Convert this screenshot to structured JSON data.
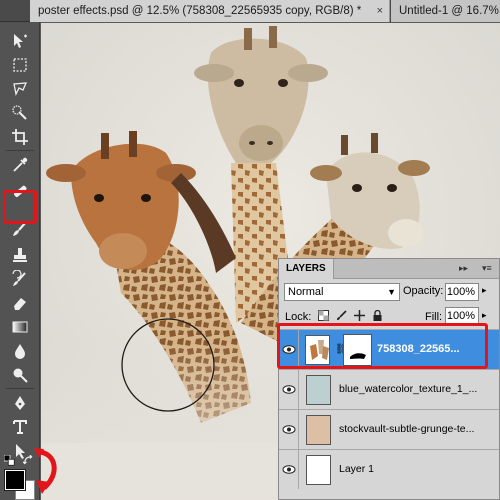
{
  "tabs": [
    {
      "title": "poster effects.psd @ 12.5% (758308_22565935 copy, RGB/8) *",
      "close": "×"
    },
    {
      "title": "Untitled-1 @ 16.7%"
    }
  ],
  "toolbar": {
    "tools": [
      "move-tool",
      "marquee-tool",
      "lasso-tool",
      "quick-selection-tool",
      "crop-tool",
      "eyedropper-tool",
      "healing-brush-tool",
      "brush-tool",
      "clone-stamp-tool",
      "history-brush-tool",
      "eraser-tool",
      "gradient-tool",
      "blur-tool",
      "dodge-tool",
      "pen-tool",
      "type-tool",
      "path-selection-tool",
      "shape-tool"
    ],
    "foreground_color": "#000000",
    "background_color": "#ffffff"
  },
  "layers_panel": {
    "title": "LAYERS",
    "blend_mode": "Normal",
    "opacity_label": "Opacity:",
    "opacity": "100%",
    "lock_label": "Lock:",
    "fill_label": "Fill:",
    "fill": "100%",
    "layers": [
      {
        "name": "758308_22565...",
        "active": true
      },
      {
        "name": "blue_watercolor_texture_1_...",
        "active": false
      },
      {
        "name": "stockvault-subtle-grunge-te...",
        "active": false
      },
      {
        "name": "Layer 1",
        "active": false
      }
    ]
  },
  "colors": {
    "highlight": "#e3151a",
    "selection": "#3e8dde"
  }
}
